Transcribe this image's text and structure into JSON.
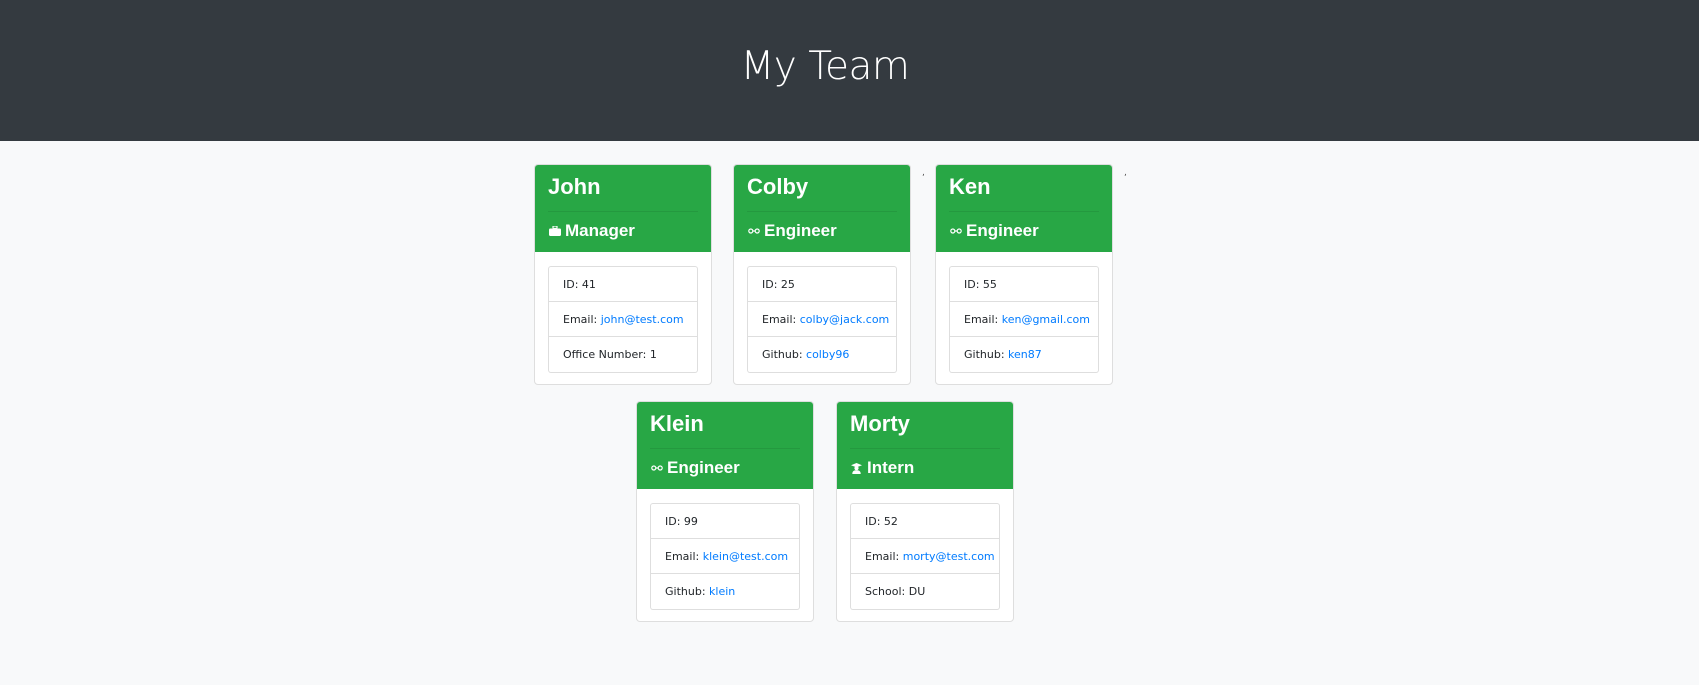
{
  "header": {
    "title": "My Team"
  },
  "colors": {
    "header_bg": "#343a40",
    "page_bg": "#f8f9fa",
    "card_header_bg": "#28a745",
    "link": "#007bff"
  },
  "stray_marks": {
    "a": ",",
    "b": ","
  },
  "employees": [
    {
      "name": "John",
      "role": "Manager",
      "role_icon": "briefcase-icon",
      "rows": [
        {
          "label": "ID:",
          "value": "41",
          "link": false
        },
        {
          "label": "Email:",
          "value": "john@test.com",
          "link": true
        },
        {
          "label": "Office Number:",
          "value": "1",
          "link": false
        }
      ]
    },
    {
      "name": "Colby",
      "role": "Engineer",
      "role_icon": "glasses-icon",
      "rows": [
        {
          "label": "ID:",
          "value": "25",
          "link": false
        },
        {
          "label": "Email:",
          "value": "colby@jack.com",
          "link": true
        },
        {
          "label": "Github:",
          "value": "colby96",
          "link": true
        }
      ]
    },
    {
      "name": "Ken",
      "role": "Engineer",
      "role_icon": "glasses-icon",
      "rows": [
        {
          "label": "ID:",
          "value": "55",
          "link": false
        },
        {
          "label": "Email:",
          "value": "ken@gmail.com",
          "link": true
        },
        {
          "label": "Github:",
          "value": "ken87",
          "link": true
        }
      ]
    },
    {
      "name": "Klein",
      "role": "Engineer",
      "role_icon": "glasses-icon",
      "rows": [
        {
          "label": "ID:",
          "value": "99",
          "link": false
        },
        {
          "label": "Email:",
          "value": "klein@test.com",
          "link": true
        },
        {
          "label": "Github:",
          "value": "klein",
          "link": true
        }
      ]
    },
    {
      "name": "Morty",
      "role": "Intern",
      "role_icon": "user-graduate-icon",
      "rows": [
        {
          "label": "ID:",
          "value": "52",
          "link": false
        },
        {
          "label": "Email:",
          "value": "morty@test.com",
          "link": true
        },
        {
          "label": "School:",
          "value": "DU",
          "link": false
        }
      ]
    }
  ]
}
